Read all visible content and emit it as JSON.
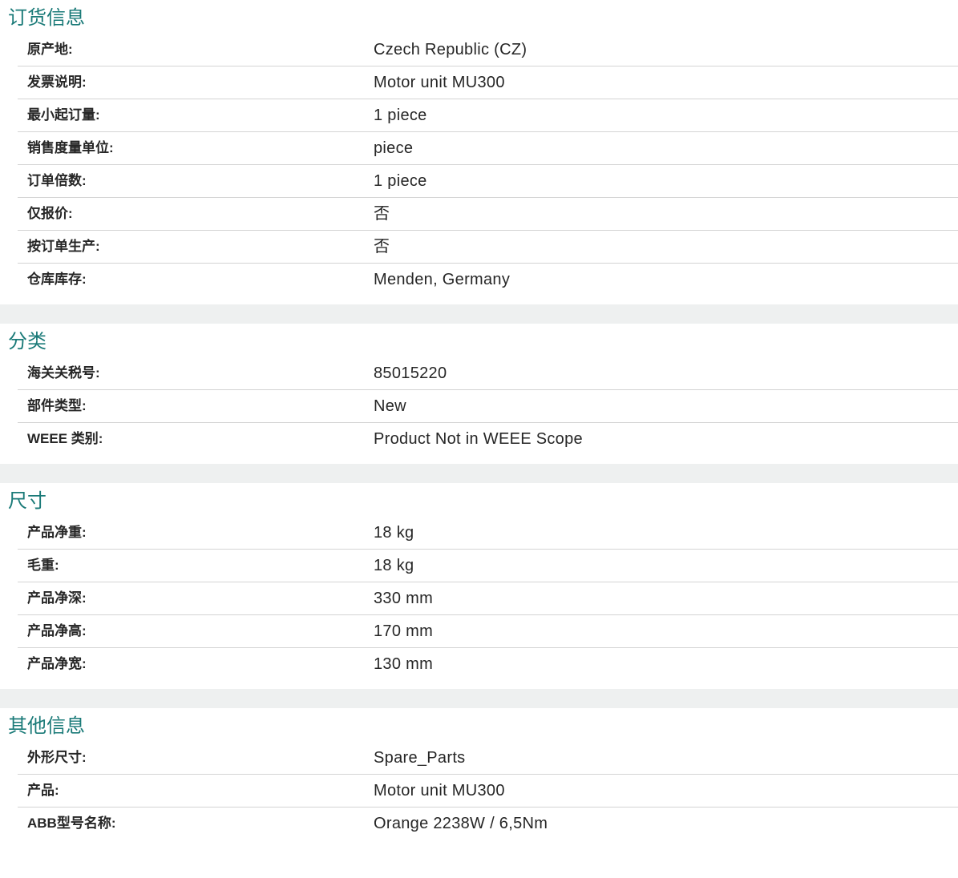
{
  "sections": [
    {
      "title": "订货信息",
      "rows": [
        {
          "label": "原产地:",
          "value": "Czech Republic (CZ)"
        },
        {
          "label": "发票说明:",
          "value": "Motor unit MU300"
        },
        {
          "label": "最小起订量:",
          "value": "1 piece"
        },
        {
          "label": "销售度量单位:",
          "value": "piece"
        },
        {
          "label": "订单倍数:",
          "value": "1 piece"
        },
        {
          "label": "仅报价:",
          "value": "否"
        },
        {
          "label": "按订单生产:",
          "value": "否"
        },
        {
          "label": "仓库库存:",
          "value": "Menden, Germany"
        }
      ]
    },
    {
      "title": "分类",
      "rows": [
        {
          "label": "海关关税号:",
          "value": "85015220"
        },
        {
          "label": "部件类型:",
          "value": "New"
        },
        {
          "label": "WEEE 类别:",
          "value": "Product Not in WEEE Scope"
        }
      ]
    },
    {
      "title": "尺寸",
      "rows": [
        {
          "label": "产品净重:",
          "value": "18 kg"
        },
        {
          "label": "毛重:",
          "value": "18 kg"
        },
        {
          "label": "产品净深:",
          "value": "330 mm"
        },
        {
          "label": "产品净高:",
          "value": "170 mm"
        },
        {
          "label": "产品净宽:",
          "value": "130 mm"
        }
      ]
    },
    {
      "title": "其他信息",
      "rows": [
        {
          "label": "外形尺寸:",
          "value": "Spare_Parts"
        },
        {
          "label": "产品:",
          "value": "Motor unit MU300"
        },
        {
          "label": "ABB型号名称:",
          "value": "Orange 2238W / 6,5Nm"
        }
      ]
    }
  ],
  "colors": {
    "section_title": "#1a7a78",
    "separator_band": "#eef0f0",
    "row_border": "#d4d4d4"
  }
}
